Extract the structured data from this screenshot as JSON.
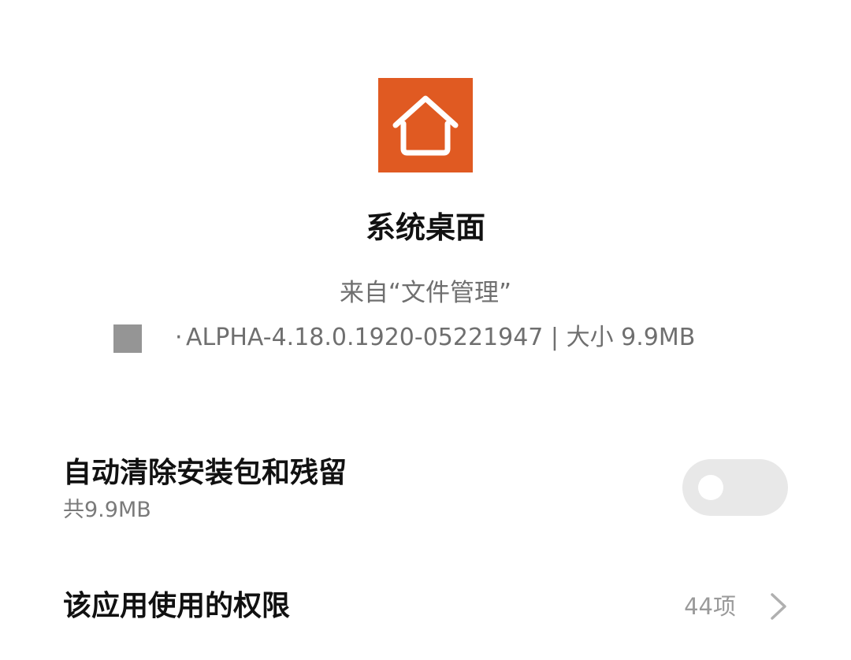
{
  "app": {
    "icon": "home-icon",
    "icon_color": "#e05a22",
    "name": "系统桌面",
    "source": "来自“文件管理”",
    "version_line": "ALPHA-4.18.0.1920-05221947 | 大小 9.9MB"
  },
  "auto_clean": {
    "title": "自动清除安装包和残留",
    "subtitle": "共9.9MB",
    "enabled": false
  },
  "permissions": {
    "title": "该应用使用的权限",
    "count": "44项",
    "chevron_icon": "chevron-right-icon"
  }
}
